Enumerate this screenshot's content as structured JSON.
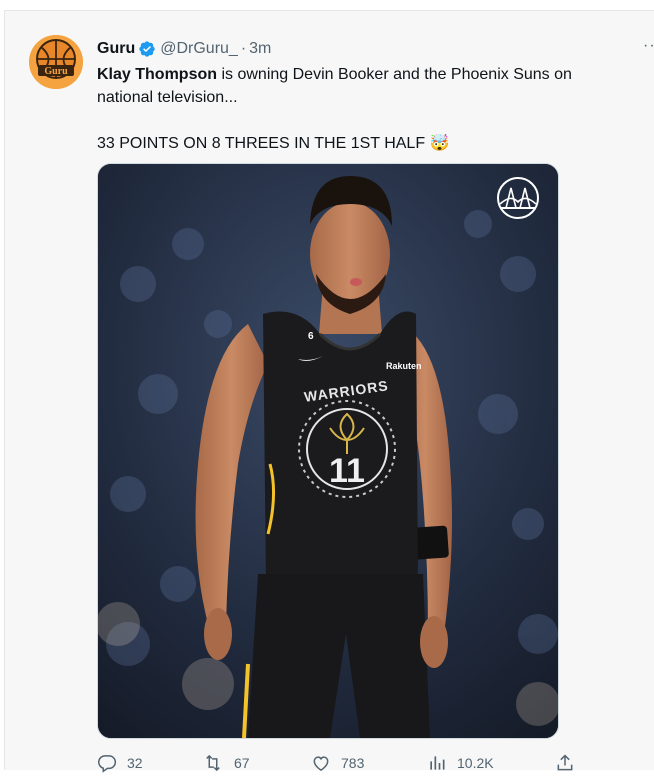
{
  "tweet": {
    "author_name": "Guru",
    "handle": "@DrGuru_",
    "separator": "·",
    "time": "3m",
    "more_label": "··",
    "text_bold": "Klay Thompson",
    "text_rest": " is owning Devin Booker and the Phoenix Suns on national television...",
    "text_line2": "33 POINTS ON 8 THREES IN THE 1ST HALF 🤯",
    "avatar_label": "Guru",
    "jersey_brand": "WARRIORS",
    "jersey_sponsor": "Rakuten",
    "jersey_number": "11",
    "jersey_small_number": "6"
  },
  "actions": {
    "replies": "32",
    "retweets": "67",
    "likes": "783",
    "views": "10.2K"
  },
  "colors": {
    "verified": "#1d9bf0",
    "secondary_text": "#536471",
    "avatar_bg": "#f4a340"
  },
  "icons": [
    "verified-badge-icon",
    "more-icon",
    "reply-icon",
    "retweet-icon",
    "like-icon",
    "views-icon",
    "share-icon",
    "bridge-logo-icon"
  ]
}
